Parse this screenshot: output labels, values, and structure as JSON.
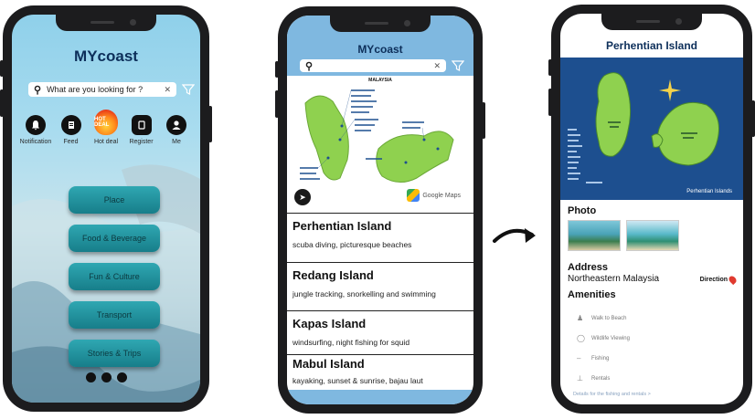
{
  "home": {
    "app_title": "MYcoast",
    "search_placeholder": "What are you looking for ?",
    "nav": [
      {
        "label": "Notification",
        "icon": "bell-icon"
      },
      {
        "label": "Feed",
        "icon": "feed-icon"
      },
      {
        "label": "Hot deal",
        "icon": "flame-icon",
        "badge": "HOT DEAL"
      },
      {
        "label": "Register",
        "icon": "clipboard-icon"
      },
      {
        "label": "Me",
        "icon": "user-icon"
      }
    ],
    "menu": [
      "Place",
      "Food & Beverage",
      "Fun & Culture",
      "Transport",
      "Stories & Trips"
    ]
  },
  "list": {
    "app_title": "MYcoast",
    "map_title": "MALAYSIA",
    "map_brand": "Google Maps",
    "islands": [
      {
        "name": "Perhentian Island",
        "desc": "scuba diving, picturesque beaches"
      },
      {
        "name": "Redang Island",
        "desc": "jungle tracking, snorkelling and swimming"
      },
      {
        "name": "Kapas Island",
        "desc": "windsurfing, night fishing for squid"
      },
      {
        "name": "Mabul Island",
        "desc": "kayaking, sunset & sunrise, bajau laut"
      }
    ]
  },
  "detail": {
    "title": "Perhentian Island",
    "map_caption": "Perhentian Islands",
    "photo_label": "Photo",
    "address_label": "Address",
    "address_value": "Northeastern Malaysia",
    "direction_label": "Direction",
    "amenities_label": "Amenities",
    "amenities": [
      {
        "label": "Walk to Beach",
        "icon": "walk-icon"
      },
      {
        "label": "Wildlife Viewing",
        "icon": "binoculars-icon"
      },
      {
        "label": "Fishing",
        "icon": "fishing-icon"
      },
      {
        "label": "Rentals",
        "icon": "rentals-icon"
      }
    ],
    "amenities_more": "Details for the fishing and rentals >"
  },
  "colors": {
    "title_navy": "#0d2f5a",
    "teal_button": "#1f8f9a",
    "header_blue": "#7fb8e0",
    "map_sea": "#1d4f8f",
    "island_green": "#8fd14f"
  }
}
